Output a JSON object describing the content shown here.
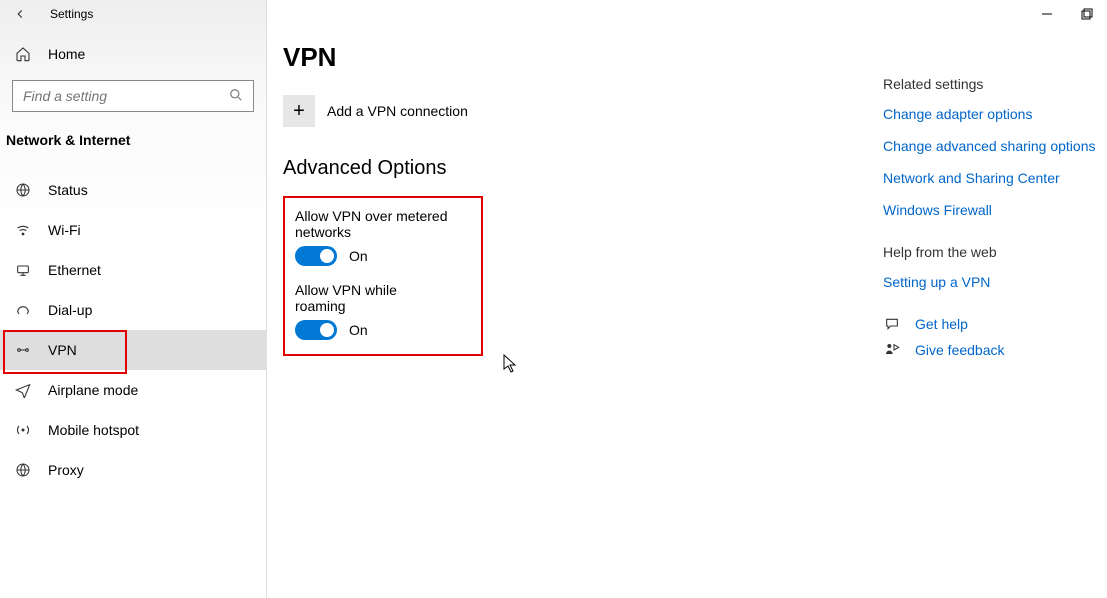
{
  "window": {
    "app_title": "Settings",
    "controls": {
      "minimize": "−",
      "maximize": "▢"
    }
  },
  "sidebar": {
    "home_label": "Home",
    "search_placeholder": "Find a setting",
    "section_label": "Network & Internet",
    "items": [
      {
        "label": "Status"
      },
      {
        "label": "Wi-Fi"
      },
      {
        "label": "Ethernet"
      },
      {
        "label": "Dial-up"
      },
      {
        "label": "VPN"
      },
      {
        "label": "Airplane mode"
      },
      {
        "label": "Mobile hotspot"
      },
      {
        "label": "Proxy"
      }
    ]
  },
  "main": {
    "title": "VPN",
    "add_label": "Add a VPN connection",
    "advanced_heading": "Advanced Options",
    "settings": [
      {
        "label": "Allow VPN over metered networks",
        "state": "On"
      },
      {
        "label": "Allow VPN while roaming",
        "state": "On"
      }
    ]
  },
  "right": {
    "related_heading": "Related settings",
    "related_links": [
      "Change adapter options",
      "Change advanced sharing options",
      "Network and Sharing Center",
      "Windows Firewall"
    ],
    "help_heading": "Help from the web",
    "help_links": [
      "Setting up a VPN"
    ],
    "get_help": "Get help",
    "feedback": "Give feedback"
  }
}
